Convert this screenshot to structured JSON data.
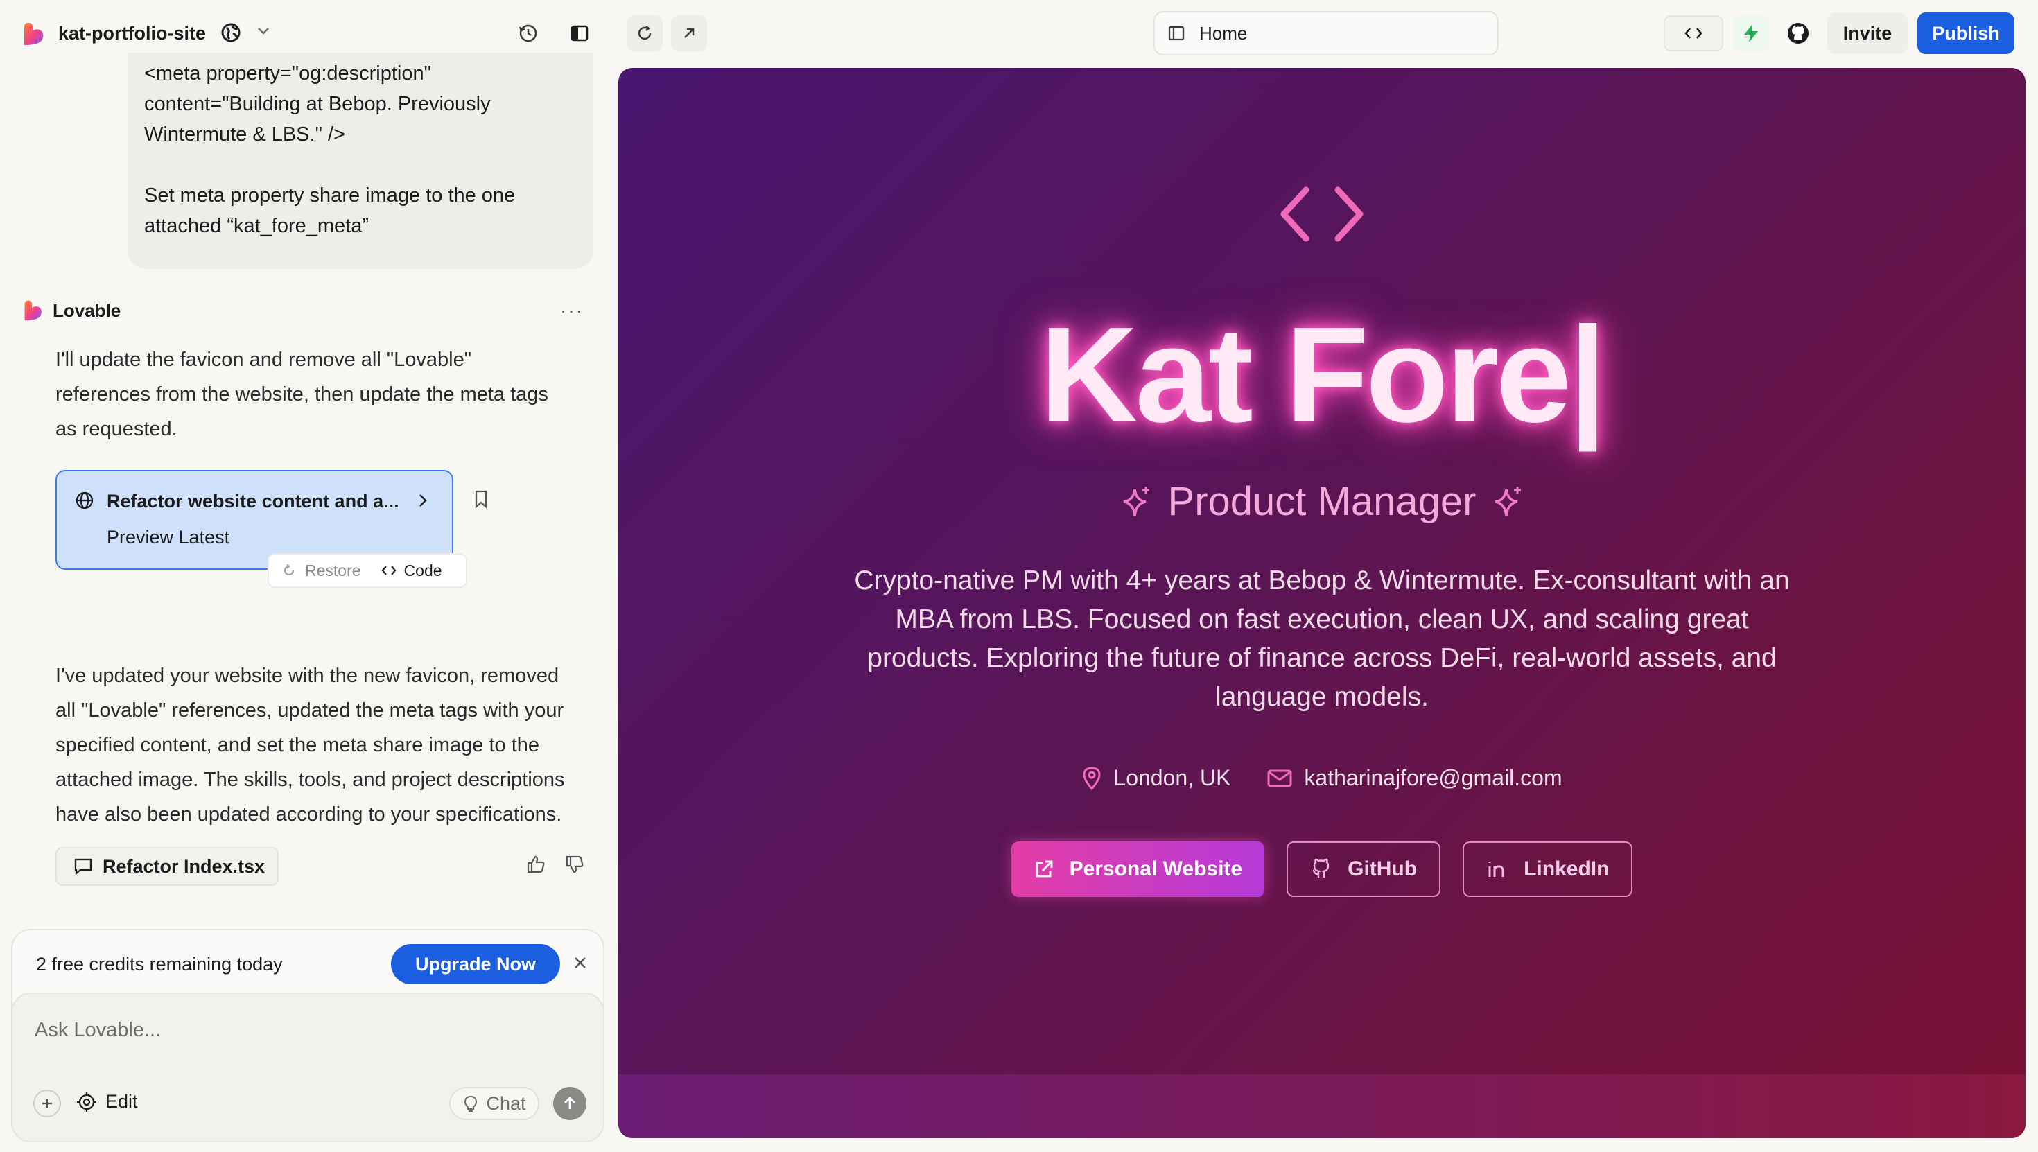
{
  "app": {
    "project_name": "kat-portfolio-site"
  },
  "topbar": {
    "address": "Home",
    "invite_label": "Invite",
    "publish_label": "Publish"
  },
  "chat": {
    "user_message": "<meta property=\"og:description\"\ncontent=\"Building at Bebop. Previously\nWintermute & LBS.\" />\n\nSet meta property share image to the one\nattached “kat_fore_meta”",
    "assistant_name": "Lovable",
    "message_intro": "I'll update the favicon and remove all \"Lovable\" references from the website, then update the meta tags as requested.",
    "change_card": {
      "title": "Refactor website content and a...",
      "subtitle": "Preview Latest",
      "restore_label": "Restore",
      "code_label": "Code"
    },
    "message_summary": "I've updated your website with the new favicon, removed all \"Lovable\" references, updated the meta tags with your specified content, and set the meta share image to the attached image. The skills, tools, and project descriptions have also been updated according to your specifications.",
    "file_tag": "Refactor Index.tsx",
    "credits_text": "2 free credits remaining today",
    "upgrade_label": "Upgrade Now",
    "input_placeholder": "Ask Lovable...",
    "edit_label": "Edit",
    "chat_mode_label": "Chat"
  },
  "preview": {
    "name": "Kat Fore|",
    "role": "Product Manager",
    "bio": "Crypto-native PM with 4+ years at Bebop & Wintermute. Ex-consultant with an MBA from LBS. Focused on fast execution, clean UX, and scaling great products. Exploring the future of finance across DeFi, real-world assets, and language models.",
    "location": "London, UK",
    "email": "katharinajfore@gmail.com",
    "buttons": {
      "website": "Personal Website",
      "github": "GitHub",
      "linkedin": "LinkedIn"
    }
  },
  "colors": {
    "accent_blue": "#1b5fe0",
    "pink": "#f5a8da",
    "bolt_green": "#22b455"
  }
}
